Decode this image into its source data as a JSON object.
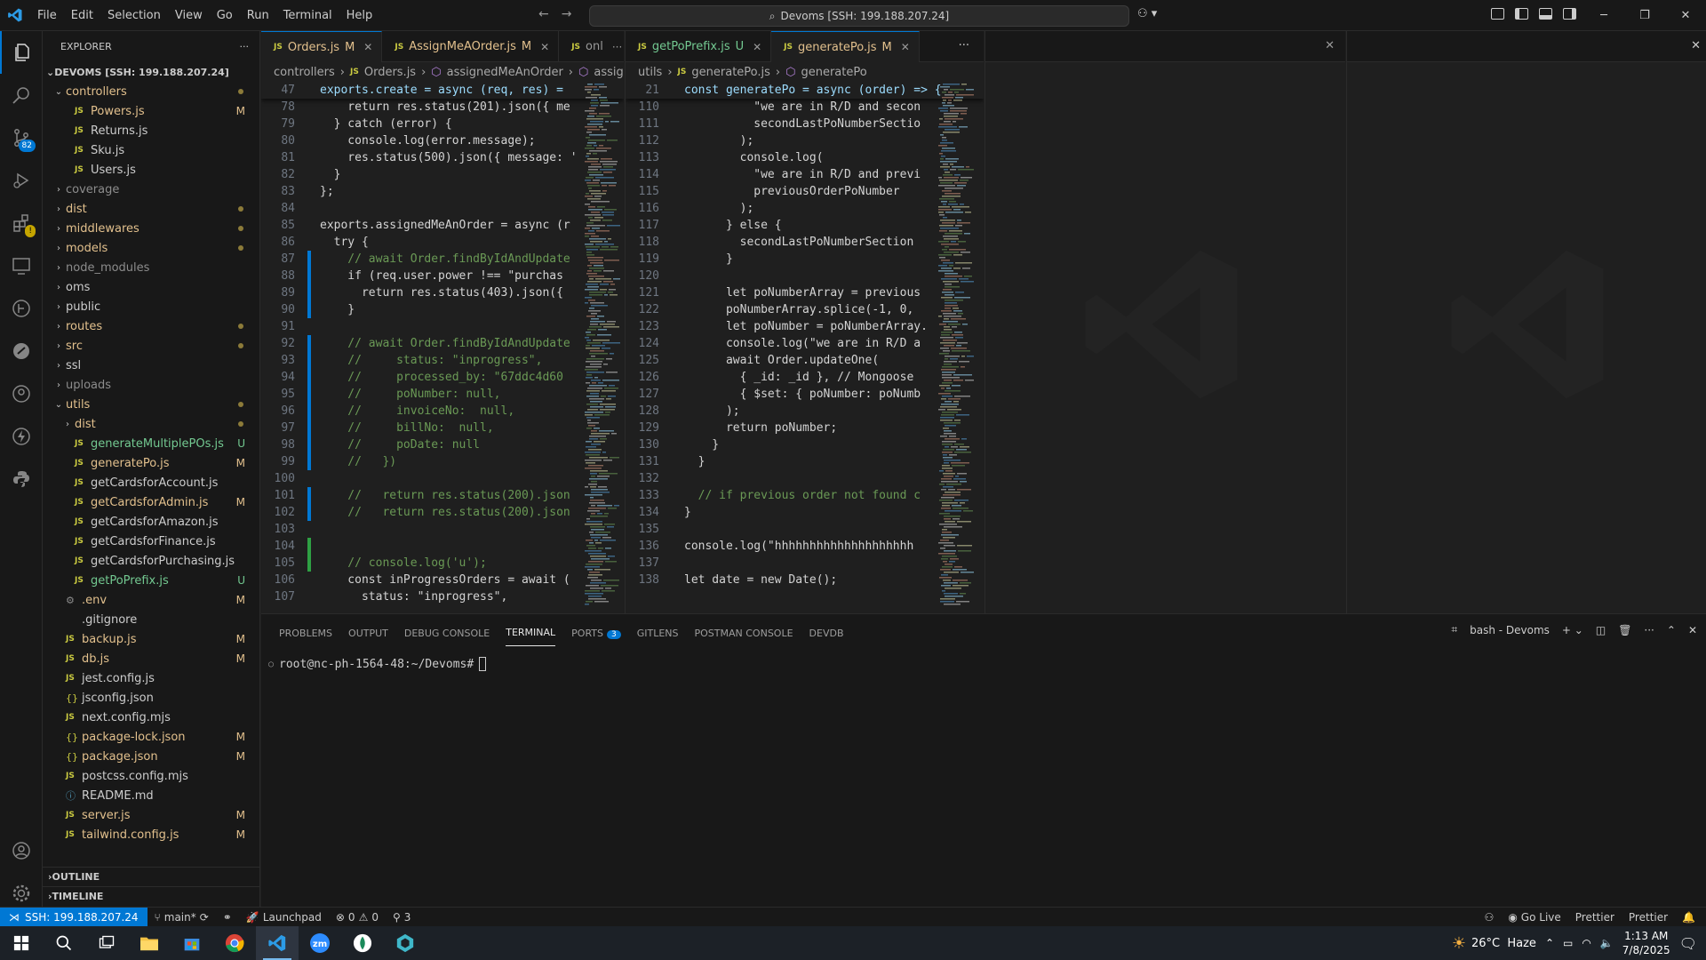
{
  "titlebar": {
    "menu": [
      "File",
      "Edit",
      "Selection",
      "View",
      "Go",
      "Run",
      "Terminal",
      "Help"
    ],
    "search": "Devoms [SSH: 199.188.207.24]"
  },
  "activity_badges": {
    "source_control": "82"
  },
  "explorer": {
    "title": "EXPLORER",
    "root": "DEVOMS [SSH: 199.188.207.24]",
    "items": [
      {
        "label": "controllers",
        "type": "folder-open",
        "depth": 1,
        "status": "dot",
        "color": "mod"
      },
      {
        "label": "Powers.js",
        "type": "js",
        "depth": 2,
        "status": "M",
        "color": "mod"
      },
      {
        "label": "Returns.js",
        "type": "js",
        "depth": 2,
        "status": "",
        "color": ""
      },
      {
        "label": "Sku.js",
        "type": "js",
        "depth": 2,
        "status": "",
        "color": ""
      },
      {
        "label": "Users.js",
        "type": "js",
        "depth": 2,
        "status": "",
        "color": ""
      },
      {
        "label": "coverage",
        "type": "folder",
        "depth": 1,
        "status": "",
        "color": "ign"
      },
      {
        "label": "dist",
        "type": "folder",
        "depth": 1,
        "status": "dot",
        "color": "mod"
      },
      {
        "label": "middlewares",
        "type": "folder",
        "depth": 1,
        "status": "dot",
        "color": "mod"
      },
      {
        "label": "models",
        "type": "folder",
        "depth": 1,
        "status": "dot",
        "color": "mod"
      },
      {
        "label": "node_modules",
        "type": "folder",
        "depth": 1,
        "status": "",
        "color": "ign"
      },
      {
        "label": "oms",
        "type": "folder",
        "depth": 1,
        "status": "",
        "color": ""
      },
      {
        "label": "public",
        "type": "folder",
        "depth": 1,
        "status": "",
        "color": ""
      },
      {
        "label": "routes",
        "type": "folder",
        "depth": 1,
        "status": "dot",
        "color": "mod"
      },
      {
        "label": "src",
        "type": "folder",
        "depth": 1,
        "status": "dot",
        "color": "mod"
      },
      {
        "label": "ssl",
        "type": "folder",
        "depth": 1,
        "status": "",
        "color": ""
      },
      {
        "label": "uploads",
        "type": "folder",
        "depth": 1,
        "status": "",
        "color": "ign"
      },
      {
        "label": "utils",
        "type": "folder-open",
        "depth": 1,
        "status": "dot",
        "color": "mod"
      },
      {
        "label": "dist",
        "type": "folder",
        "depth": 2,
        "status": "dot",
        "color": "mod"
      },
      {
        "label": "generateMultiplePOs.js",
        "type": "js",
        "depth": 2,
        "status": "U",
        "color": "untr"
      },
      {
        "label": "generatePo.js",
        "type": "js",
        "depth": 2,
        "status": "M",
        "color": "mod"
      },
      {
        "label": "getCardsforAccount.js",
        "type": "js",
        "depth": 2,
        "status": "",
        "color": ""
      },
      {
        "label": "getCardsforAdmin.js",
        "type": "js",
        "depth": 2,
        "status": "M",
        "color": "mod"
      },
      {
        "label": "getCardsforAmazon.js",
        "type": "js",
        "depth": 2,
        "status": "",
        "color": ""
      },
      {
        "label": "getCardsforFinance.js",
        "type": "js",
        "depth": 2,
        "status": "",
        "color": ""
      },
      {
        "label": "getCardsforPurchasing.js",
        "type": "js",
        "depth": 2,
        "status": "",
        "color": ""
      },
      {
        "label": "getPoPrefix.js",
        "type": "js",
        "depth": 2,
        "status": "U",
        "color": "untr"
      },
      {
        "label": ".env",
        "type": "gear",
        "depth": 1,
        "status": "M",
        "color": "mod"
      },
      {
        "label": ".gitignore",
        "type": "plain",
        "depth": 1,
        "status": "",
        "color": ""
      },
      {
        "label": "backup.js",
        "type": "js",
        "depth": 1,
        "status": "M",
        "color": "mod"
      },
      {
        "label": "db.js",
        "type": "js",
        "depth": 1,
        "status": "M",
        "color": "mod"
      },
      {
        "label": "jest.config.js",
        "type": "js",
        "depth": 1,
        "status": "",
        "color": ""
      },
      {
        "label": "jsconfig.json",
        "type": "json",
        "depth": 1,
        "status": "",
        "color": ""
      },
      {
        "label": "next.config.mjs",
        "type": "js",
        "depth": 1,
        "status": "",
        "color": ""
      },
      {
        "label": "package-lock.json",
        "type": "json",
        "depth": 1,
        "status": "M",
        "color": "mod"
      },
      {
        "label": "package.json",
        "type": "json",
        "depth": 1,
        "status": "M",
        "color": "mod"
      },
      {
        "label": "postcss.config.mjs",
        "type": "js",
        "depth": 1,
        "status": "",
        "color": ""
      },
      {
        "label": "README.md",
        "type": "info",
        "depth": 1,
        "status": "",
        "color": ""
      },
      {
        "label": "server.js",
        "type": "js",
        "depth": 1,
        "status": "M",
        "color": "mod"
      },
      {
        "label": "tailwind.config.js",
        "type": "js",
        "depth": 1,
        "status": "M",
        "color": "mod"
      }
    ],
    "outline": "OUTLINE",
    "timeline": "TIMELINE"
  },
  "editor_left": {
    "tabs": [
      {
        "label": "Orders.js",
        "status": "M",
        "active": true
      },
      {
        "label": "AssignMeAOrder.js",
        "status": "M",
        "active": false
      },
      {
        "label": "onl",
        "status": "",
        "active": false
      }
    ],
    "breadcrumbs": [
      "controllers",
      "Orders.js",
      "assignedMeAnOrder",
      "assigned"
    ],
    "sticky": {
      "n": "47",
      "t": "exports.create = async (req, res) ="
    },
    "lines": [
      {
        "n": "78",
        "t": "    return res.status(201).json({ me",
        "g": ""
      },
      {
        "n": "79",
        "t": "  } catch (error) {",
        "g": ""
      },
      {
        "n": "80",
        "t": "    console.log(error.message);",
        "g": ""
      },
      {
        "n": "81",
        "t": "    res.status(500).json({ message: '",
        "g": ""
      },
      {
        "n": "82",
        "t": "  }",
        "g": ""
      },
      {
        "n": "83",
        "t": "};",
        "g": ""
      },
      {
        "n": "84",
        "t": "",
        "g": ""
      },
      {
        "n": "85",
        "t": "exports.assignedMeAnOrder = async (r",
        "g": ""
      },
      {
        "n": "86",
        "t": "  try {",
        "g": ""
      },
      {
        "n": "87",
        "t": "    // await Order.findByIdAndUpdate",
        "g": "b"
      },
      {
        "n": "88",
        "t": "    if (req.user.power !== \"purchas",
        "g": "b"
      },
      {
        "n": "89",
        "t": "      return res.status(403).json({",
        "g": "b"
      },
      {
        "n": "90",
        "t": "    }",
        "g": "b"
      },
      {
        "n": "91",
        "t": "",
        "g": ""
      },
      {
        "n": "92",
        "t": "    // await Order.findByIdAndUpdate",
        "g": "b"
      },
      {
        "n": "93",
        "t": "    //     status: \"inprogress\",",
        "g": "b"
      },
      {
        "n": "94",
        "t": "    //     processed_by: \"67ddc4d60",
        "g": "b"
      },
      {
        "n": "95",
        "t": "    //     poNumber: null,",
        "g": "b"
      },
      {
        "n": "96",
        "t": "    //     invoiceNo:  null,",
        "g": "b"
      },
      {
        "n": "97",
        "t": "    //     billNo:  null,",
        "g": "b"
      },
      {
        "n": "98",
        "t": "    //     poDate: null",
        "g": "b"
      },
      {
        "n": "99",
        "t": "    //   })",
        "g": "b"
      },
      {
        "n": "100",
        "t": "",
        "g": ""
      },
      {
        "n": "101",
        "t": "    //   return res.status(200).json",
        "g": "b"
      },
      {
        "n": "102",
        "t": "    //   return res.status(200).json",
        "g": "b"
      },
      {
        "n": "103",
        "t": "",
        "g": ""
      },
      {
        "n": "104",
        "t": "",
        "g": "g"
      },
      {
        "n": "105",
        "t": "    // console.log('u');",
        "g": "g"
      },
      {
        "n": "106",
        "t": "    const inProgressOrders = await (",
        "g": ""
      },
      {
        "n": "107",
        "t": "      status: \"inprogress\",",
        "g": ""
      }
    ]
  },
  "editor_right": {
    "tabs": [
      {
        "label": "getPoPrefix.js",
        "status": "U",
        "active": false
      },
      {
        "label": "generatePo.js",
        "status": "M",
        "active": true
      }
    ],
    "breadcrumbs": [
      "utils",
      "generatePo.js",
      "generatePo"
    ],
    "sticky": {
      "n": "21",
      "t": "const generatePo = async (order) => {"
    },
    "lines": [
      {
        "n": "110",
        "t": "          \"we are in R/D and secon",
        "g": ""
      },
      {
        "n": "111",
        "t": "          secondLastPoNumberSectio",
        "g": ""
      },
      {
        "n": "112",
        "t": "        );",
        "g": ""
      },
      {
        "n": "113",
        "t": "        console.log(",
        "g": ""
      },
      {
        "n": "114",
        "t": "          \"we are in R/D and previ",
        "g": ""
      },
      {
        "n": "115",
        "t": "          previousOrderPoNumber",
        "g": ""
      },
      {
        "n": "116",
        "t": "        );",
        "g": ""
      },
      {
        "n": "117",
        "t": "      } else {",
        "g": ""
      },
      {
        "n": "118",
        "t": "        secondLastPoNumberSection",
        "g": ""
      },
      {
        "n": "119",
        "t": "      }",
        "g": ""
      },
      {
        "n": "120",
        "t": "",
        "g": ""
      },
      {
        "n": "121",
        "t": "      let poNumberArray = previous",
        "g": ""
      },
      {
        "n": "122",
        "t": "      poNumberArray.splice(-1, 0,",
        "g": ""
      },
      {
        "n": "123",
        "t": "      let poNumber = poNumberArray.",
        "g": ""
      },
      {
        "n": "124",
        "t": "      console.log(\"we are in R/D a",
        "g": ""
      },
      {
        "n": "125",
        "t": "      await Order.updateOne(",
        "g": ""
      },
      {
        "n": "126",
        "t": "        { _id: _id }, // Mongoose",
        "g": ""
      },
      {
        "n": "127",
        "t": "        { $set: { poNumber: poNumb",
        "g": ""
      },
      {
        "n": "128",
        "t": "      );",
        "g": ""
      },
      {
        "n": "129",
        "t": "      return poNumber;",
        "g": ""
      },
      {
        "n": "130",
        "t": "    }",
        "g": ""
      },
      {
        "n": "131",
        "t": "  }",
        "g": ""
      },
      {
        "n": "132",
        "t": "",
        "g": ""
      },
      {
        "n": "133",
        "t": "  // if previous order not found c",
        "g": ""
      },
      {
        "n": "134",
        "t": "}",
        "g": ""
      },
      {
        "n": "135",
        "t": "",
        "g": ""
      },
      {
        "n": "136",
        "t": "console.log(\"hhhhhhhhhhhhhhhhhhhh",
        "g": ""
      },
      {
        "n": "137",
        "t": "",
        "g": ""
      },
      {
        "n": "138",
        "t": "let date = new Date();",
        "g": ""
      }
    ]
  },
  "panel": {
    "tabs": [
      "PROBLEMS",
      "OUTPUT",
      "DEBUG CONSOLE",
      "TERMINAL",
      "PORTS",
      "GITLENS",
      "POSTMAN CONSOLE",
      "DEVDB"
    ],
    "active_tab": "TERMINAL",
    "ports_badge": "3",
    "terminal_name": "bash - Devoms",
    "prompt": "root@nc-ph-1564-48:~/Devoms#"
  },
  "statusbar": {
    "remote": "SSH: 199.188.207.24",
    "branch": "main*",
    "launchpad": "Launchpad",
    "errors": "0",
    "warnings": "0",
    "ports": "3",
    "golive": "Go Live",
    "prettier1": "Prettier",
    "prettier2": "Prettier"
  },
  "taskbar": {
    "weather": "26°C  Haze",
    "time": "1:13 AM",
    "date": "7/8/2025"
  }
}
